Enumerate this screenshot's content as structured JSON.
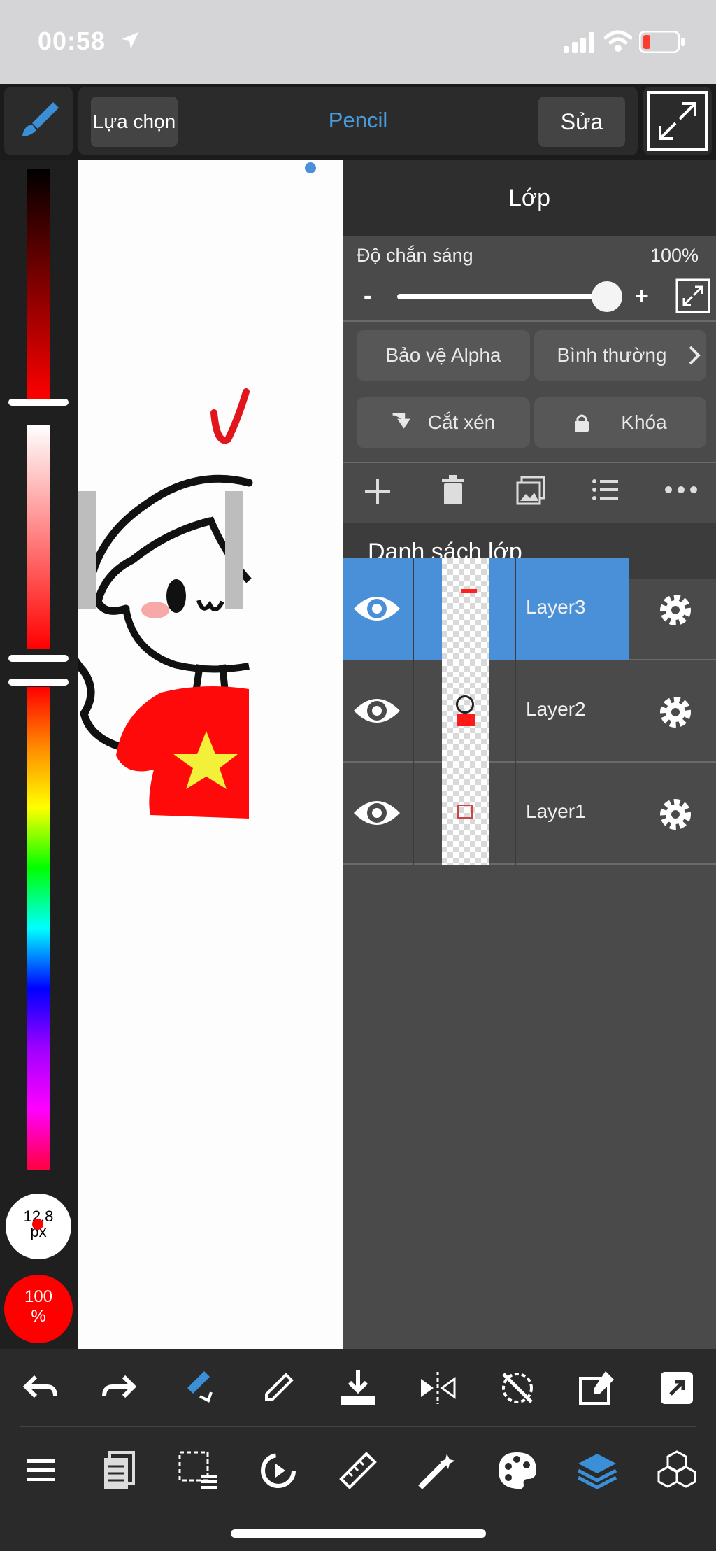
{
  "status_bar": {
    "time": "00:58"
  },
  "toolbar": {
    "selection_label": "Lựa chọn",
    "tool_name": "Pencil",
    "edit_label": "Sửa"
  },
  "color_panel": {
    "brush_size": "12.8",
    "brush_unit": "px",
    "opacity": "100",
    "opacity_unit": "%"
  },
  "layer_panel": {
    "title": "Lớp",
    "opacity_label": "Độ chắn sáng",
    "opacity_value": "100%",
    "opacity_fraction": 1.0,
    "minus_label": "-",
    "plus_label": "+",
    "alpha_protect_label": "Bảo vệ Alpha",
    "blend_mode_label": "Bình thường",
    "clipping_label": "Cắt xén",
    "lock_label": "Khóa",
    "list_title": "Danh sách lớp",
    "layers": [
      {
        "name": "Layer3",
        "selected": true
      },
      {
        "name": "Layer2",
        "selected": false
      },
      {
        "name": "Layer1",
        "selected": false
      }
    ]
  },
  "colors": {
    "accent": "#4a90d9",
    "selected_row": "#4a90d9",
    "brush_color": "#ff0000"
  }
}
